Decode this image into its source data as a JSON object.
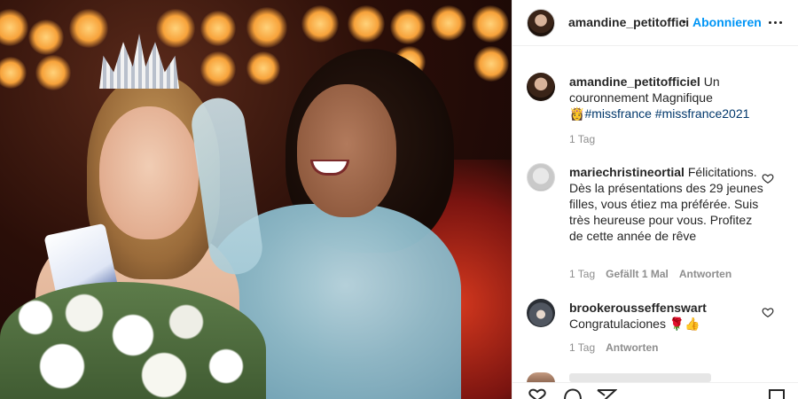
{
  "post": {
    "username": "amandine_petitoffici",
    "separator": "•",
    "follow_label": "Abonnieren"
  },
  "caption": {
    "username": "amandine_petitofficiel",
    "text": "Un couronnement Magnifique",
    "emoji": "👸",
    "hashtags": [
      "#missfrance",
      "#missfrance2021"
    ],
    "time": "1 Tag"
  },
  "comments": [
    {
      "username": "mariechristineortial",
      "text": "Félicitations. Dès la présentations des 29 jeunes filles, vous étiez ma préférée. Suis très heureuse pour vous. Profitez de cette année de rêve",
      "time": "1 Tag",
      "likes": "Gefällt 1 Mal",
      "reply_label": "Antworten"
    },
    {
      "username": "brookerousseffenswart",
      "text": "Congratulaciones",
      "emoji": "🌹👍",
      "time": "1 Tag",
      "reply_label": "Antworten"
    }
  ],
  "icons": {
    "more": "more-options-icon",
    "like": "heart-outline-icon",
    "comment": "comment-bubble-icon",
    "share": "paper-plane-icon",
    "save": "bookmark-icon"
  },
  "colors": {
    "link_blue": "#0095f6",
    "hashtag": "#00376b",
    "muted": "#8e8e8e",
    "text": "#262626"
  }
}
